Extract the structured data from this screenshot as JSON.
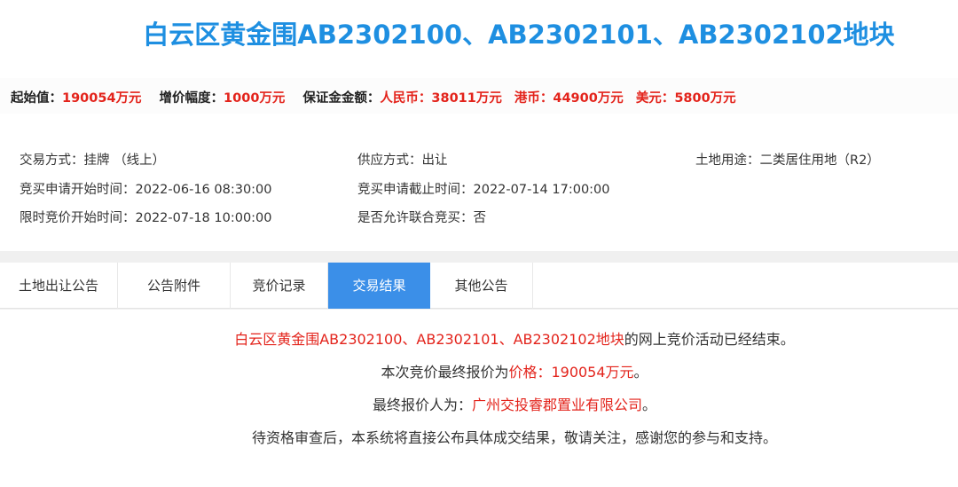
{
  "header": {
    "title": "白云区黄金围AB2302100、AB2302101、AB2302102地块"
  },
  "price": {
    "start_label": "起始值：",
    "start_value": "190054万元",
    "increment_label": "增价幅度：",
    "increment_value": "1000万元",
    "deposit_label": "保证金金额：",
    "rmb_label": "人民币：",
    "rmb_value": "38011万元",
    "hkd_label": "港币：",
    "hkd_value": "44900万元",
    "usd_label": "美元：",
    "usd_value": "5800万元"
  },
  "info": {
    "trade_mode_label": "交易方式：",
    "trade_mode_value": "挂牌 （线上）",
    "supply_label": "供应方式：",
    "supply_value": "出让",
    "use_label": "土地用途：",
    "use_value": "二类居住用地（R2）",
    "apply_start_label": "竞买申请开始时间：",
    "apply_start_value": "2022-06-16 08:30:00",
    "apply_end_label": "竞买申请截止时间：",
    "apply_end_value": "2022-07-14 17:00:00",
    "bid_start_label": "限时竞价开始时间：",
    "bid_start_value": "2022-07-18 10:00:00",
    "joint_label": "是否允许联合竞买：",
    "joint_value": "否"
  },
  "tabs": [
    {
      "label": "土地出让公告"
    },
    {
      "label": "公告附件"
    },
    {
      "label": "竞价记录"
    },
    {
      "label": "交易结果"
    },
    {
      "label": "其他公告"
    }
  ],
  "active_tab": "交易结果",
  "result": {
    "line1_red": "白云区黄金围AB2302100、AB2302101、AB2302102地块",
    "line1_rest": "的网上竞价活动已经结束。",
    "line2_prefix": "本次竞价最终报价为",
    "line2_red": "价格：190054万元",
    "line2_suffix": "。",
    "line3_prefix": "最终报价人为：",
    "line3_red": "广州交投睿郡置业有限公司",
    "line3_suffix": "。",
    "line4": "待资格审查后，本系统将直接公布具体成交结果，敬请关注，感谢您的参与和支持。"
  },
  "colors": {
    "title_blue": "#1e8fe1",
    "value_red": "#e3231b",
    "active_tab_bg": "#3b8fe8"
  }
}
